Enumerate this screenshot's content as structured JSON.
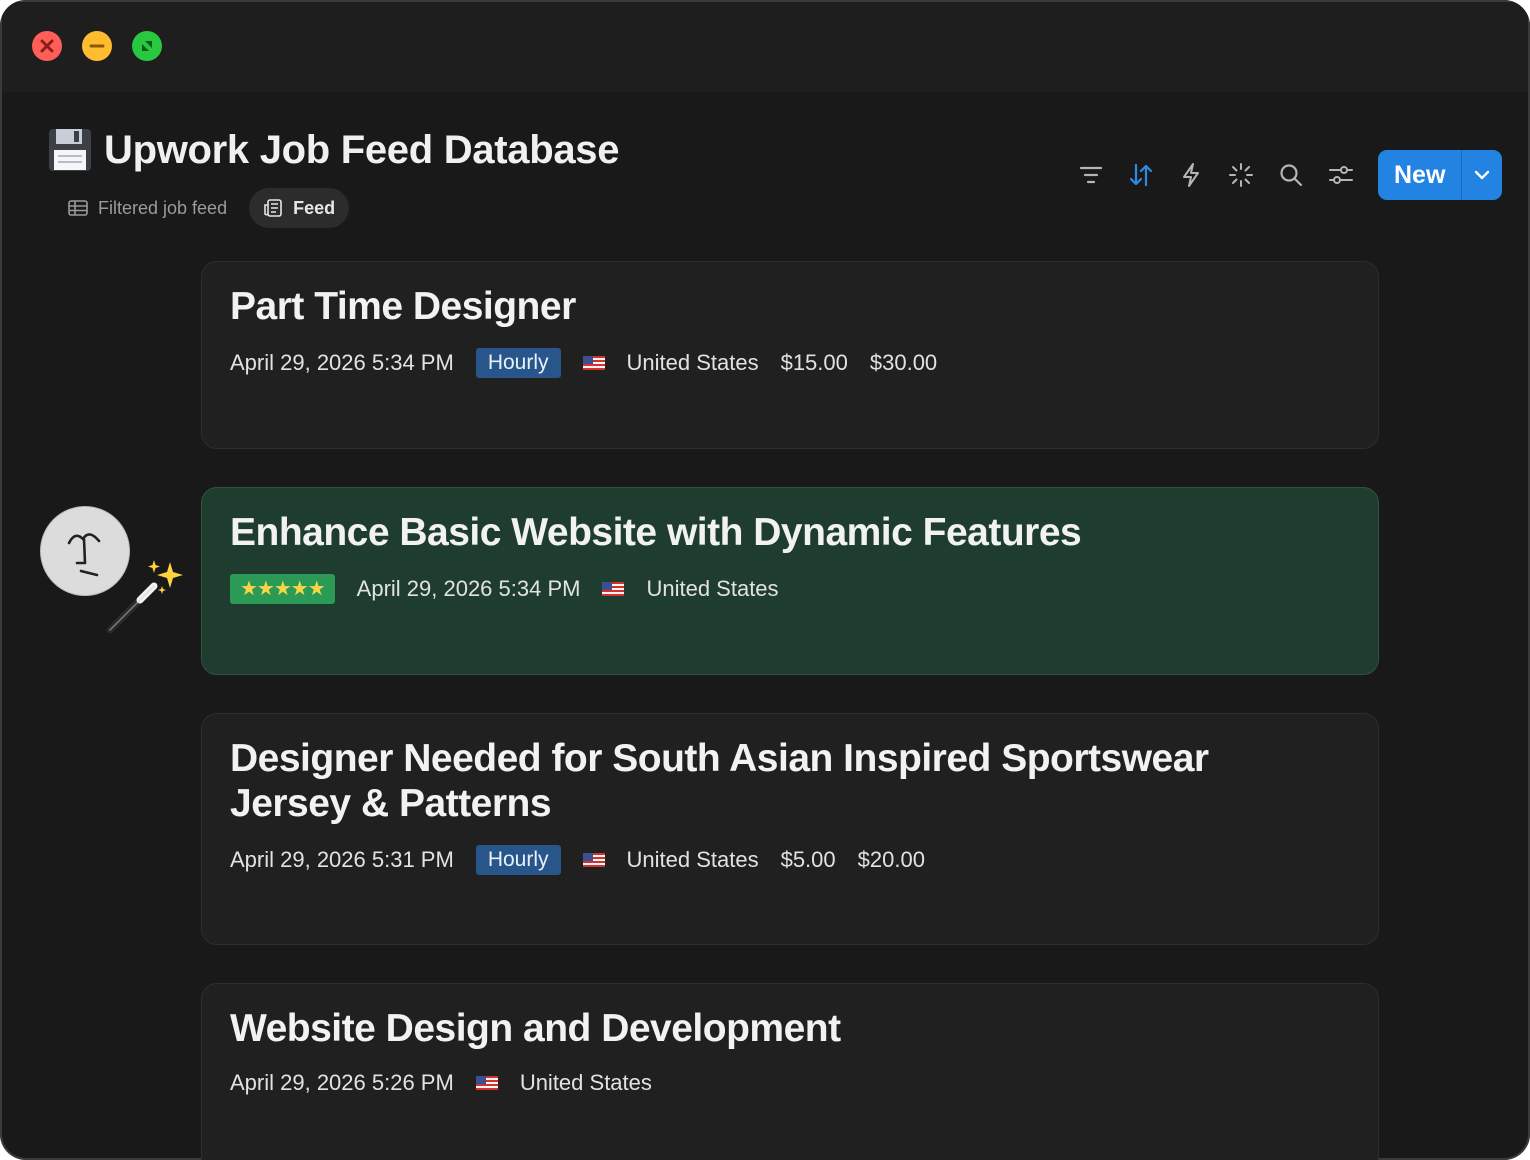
{
  "window": {
    "title": "Upwork Job Feed Database",
    "title_icon": "floppy-disk-icon"
  },
  "views": [
    {
      "label": "Filtered job feed",
      "icon": "table-icon",
      "active": false
    },
    {
      "label": "Feed",
      "icon": "feed-icon",
      "active": true
    }
  ],
  "toolbar": {
    "icons": [
      "filter-icon",
      "sort-icon",
      "automation-icon",
      "ai-sparkle-icon",
      "search-icon",
      "settings-icon"
    ],
    "new_label": "New",
    "accent": "#2383e2"
  },
  "jobs": [
    {
      "title": "Part Time Designer",
      "date": "April 29, 2026 5:34 PM",
      "type": "Hourly",
      "country": "United States",
      "rate_min": "$15.00",
      "rate_max": "$30.00"
    },
    {
      "title": "Enhance Basic Website with Dynamic Features",
      "rating": "★★★★★",
      "date": "April 29, 2026 5:34 PM",
      "country": "United States",
      "highlight_color": "#1f3d2f"
    },
    {
      "title": "Designer Needed for South Asian Inspired Sportswear Jersey & Patterns",
      "date": "April 29, 2026 5:31 PM",
      "type": "Hourly",
      "country": "United States",
      "rate_min": "$5.00",
      "rate_max": "$20.00"
    },
    {
      "title": "Website Design and Development",
      "date": "April 29, 2026 5:26 PM",
      "country": "United States"
    }
  ]
}
